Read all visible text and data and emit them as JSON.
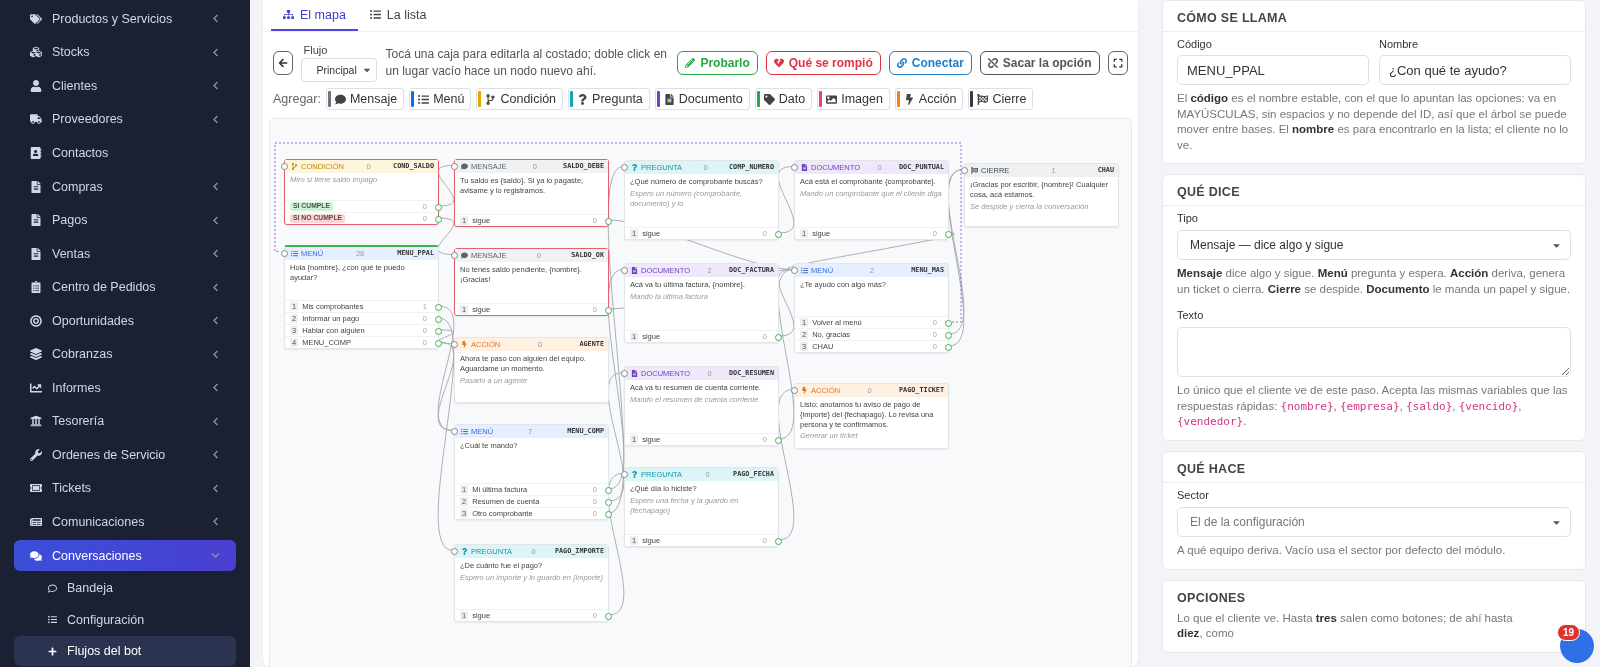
{
  "sidebar": {
    "items": [
      {
        "label": "Productos y Servicios",
        "has_submenu": true,
        "expanded": false,
        "selected": false
      },
      {
        "label": "Stocks",
        "has_submenu": true,
        "expanded": false,
        "selected": false
      },
      {
        "label": "Clientes",
        "has_submenu": true,
        "expanded": false,
        "selected": false
      },
      {
        "label": "Proveedores",
        "has_submenu": true,
        "expanded": false,
        "selected": false
      },
      {
        "label": "Contactos",
        "has_submenu": false,
        "expanded": false,
        "selected": false
      },
      {
        "label": "Compras",
        "has_submenu": true,
        "expanded": false,
        "selected": false
      },
      {
        "label": "Pagos",
        "has_submenu": true,
        "expanded": false,
        "selected": false
      },
      {
        "label": "Ventas",
        "has_submenu": true,
        "expanded": false,
        "selected": false
      },
      {
        "label": "Centro de Pedidos",
        "has_submenu": true,
        "expanded": false,
        "selected": false
      },
      {
        "label": "Oportunidades",
        "has_submenu": true,
        "expanded": false,
        "selected": false
      },
      {
        "label": "Cobranzas",
        "has_submenu": true,
        "expanded": false,
        "selected": false
      },
      {
        "label": "Informes",
        "has_submenu": true,
        "expanded": false,
        "selected": false
      },
      {
        "label": "Tesorería",
        "has_submenu": true,
        "expanded": false,
        "selected": false
      },
      {
        "label": "Ordenes de Servicio",
        "has_submenu": true,
        "expanded": false,
        "selected": false
      },
      {
        "label": "Tickets",
        "has_submenu": true,
        "expanded": false,
        "selected": false
      },
      {
        "label": "Comunicaciones",
        "has_submenu": true,
        "expanded": false,
        "selected": false
      },
      {
        "label": "Conversaciones",
        "has_submenu": true,
        "expanded": true,
        "selected": true,
        "children": [
          {
            "label": "Bandeja",
            "selected": false
          },
          {
            "label": "Configuración",
            "selected": false
          },
          {
            "label": "Flujos del bot",
            "selected": true
          }
        ]
      }
    ]
  },
  "tabs": [
    {
      "label": "El mapa",
      "selected": true
    },
    {
      "label": "La lista",
      "selected": false
    }
  ],
  "toolbar": {
    "flow_label": "Flujo",
    "flow_value": "Principal",
    "hint": "Tocá una caja para editarla al costado; doble click en un lugar vacío hace un nodo nuevo ahí.",
    "buttons": [
      {
        "kind": "test",
        "label": "Probarlo",
        "color": "#28a745"
      },
      {
        "kind": "broken",
        "label": "Qué se rompió",
        "color": "#dc3545"
      },
      {
        "kind": "link",
        "label": "Conectar",
        "color": "#1f7fc8"
      },
      {
        "kind": "unlink",
        "label": "Sacar la opción",
        "color": "#555555"
      }
    ]
  },
  "add_label": "Agregar:",
  "add_buttons": [
    {
      "kind": "mensaje",
      "label": "Mensaje",
      "color": "#6c757d"
    },
    {
      "kind": "menu",
      "label": "Menú",
      "color": "#0d6efd"
    },
    {
      "kind": "condicion",
      "label": "Condición",
      "color": "#e0a800"
    },
    {
      "kind": "pregunta",
      "label": "Pregunta",
      "color": "#17a2b8"
    },
    {
      "kind": "documento",
      "label": "Documento",
      "color": "#6f42c1"
    },
    {
      "kind": "dato",
      "label": "Dato",
      "color": "#28a745"
    },
    {
      "kind": "imagen",
      "label": "Imagen",
      "color": "#e83e8c"
    },
    {
      "kind": "accion",
      "label": "Acción",
      "color": "#fd7e14"
    },
    {
      "kind": "cierre",
      "label": "Cierre",
      "color": "#343a40"
    }
  ],
  "nodes": [
    {
      "kind": "condicion",
      "type_label": "CONDICIÓN",
      "count": "0",
      "code": "COND_SALDO",
      "hint": "Miro si tiene saldo impago",
      "error": true,
      "selected": false,
      "options": [
        {
          "kind": "badge",
          "label": "SI CUMPLE",
          "count": "0",
          "color": "#cdf2d6"
        },
        {
          "kind": "badge",
          "label": "SI NO CUMPLE",
          "count": "0",
          "color": "#fbd5d5"
        }
      ]
    },
    {
      "kind": "menu",
      "type_label": "MENÚ",
      "count": "28",
      "code": "MENU_PPAL",
      "text": "Hola {nombre}, ¿con qué te puedo ayudar?",
      "error": false,
      "selected": true,
      "options": [
        {
          "kind": "numbered",
          "number": "1",
          "label": "Mis comprobantes",
          "count": "1"
        },
        {
          "kind": "numbered",
          "number": "2",
          "label": "Informar un pago",
          "count": "0"
        },
        {
          "kind": "numbered",
          "number": "3",
          "label": "Hablar con alguien",
          "count": "0"
        },
        {
          "kind": "numbered",
          "number": "4",
          "label": "MENU_COMP",
          "count": "0"
        }
      ]
    },
    {
      "kind": "mensaje",
      "type_label": "MENSAJE",
      "count": "0",
      "code": "SALDO_DEBE",
      "text": "Tu saldo es {saldo}. Si ya lo pagaste, avisame y lo registramos.",
      "error": true,
      "selected": false,
      "options": [
        {
          "kind": "numbered",
          "number": "1",
          "label": "sigue",
          "count": "0"
        }
      ]
    },
    {
      "kind": "mensaje",
      "type_label": "MENSAJE",
      "count": "0",
      "code": "SALDO_OK",
      "text": "No tenés saldo pendiente, {nombre}. ¡Gracias!",
      "error": true,
      "selected": false,
      "options": [
        {
          "kind": "numbered",
          "number": "1",
          "label": "sigue",
          "count": "0"
        }
      ]
    },
    {
      "kind": "accion",
      "type_label": "ACCIÓN",
      "count": "0",
      "code": "AGENTE",
      "text": "Ahora te paso con alguien del equipo. Aguardame un momento.",
      "hint": "Pasarlo a un agente",
      "error": false,
      "selected": false
    },
    {
      "kind": "menu",
      "type_label": "MENÚ",
      "count": "7",
      "code": "MENU_COMP",
      "text": "¿Cuál te mando?",
      "error": false,
      "selected": false,
      "options": [
        {
          "kind": "numbered",
          "number": "1",
          "label": "Mi última factura",
          "count": "0"
        },
        {
          "kind": "numbered",
          "number": "2",
          "label": "Resumen de cuenta",
          "count": "0"
        },
        {
          "kind": "numbered",
          "number": "3",
          "label": "Otro comprobante",
          "count": "0"
        }
      ]
    },
    {
      "kind": "pregunta",
      "type_label": "PREGUNTA",
      "count": "0",
      "code": "PAGO_IMPORTE",
      "text": "¿De cuánto fue el pago?",
      "hint": "Espero un importe y lo guardo en {importe}",
      "error": false,
      "selected": false,
      "options": [
        {
          "kind": "numbered",
          "number": "1",
          "label": "sigue",
          "count": "0"
        }
      ]
    },
    {
      "kind": "pregunta",
      "type_label": "PREGUNTA",
      "count": "0",
      "code": "COMP_NUMERO",
      "text": "¿Qué número de comprobante buscás?",
      "hint": "Espero un número (comprobante, documento) y lo",
      "error": false,
      "selected": false,
      "options": [
        {
          "kind": "numbered",
          "number": "1",
          "label": "sigue",
          "count": "0"
        }
      ]
    },
    {
      "kind": "documento",
      "type_label": "DOCUMENTO",
      "count": "2",
      "code": "DOC_FACTURA",
      "text": "Acá va tu última factura, {nombre}.",
      "hint": "Mando la última factura",
      "error": false,
      "selected": false,
      "options": [
        {
          "kind": "numbered",
          "number": "1",
          "label": "sigue",
          "count": "0"
        }
      ]
    },
    {
      "kind": "documento",
      "type_label": "DOCUMENTO",
      "count": "0",
      "code": "DOC_RESUMEN",
      "text": "Acá va tu resumen de cuenta corriente.",
      "hint": "Mando el resumen de cuenta corriente",
      "error": false,
      "selected": false,
      "options": [
        {
          "kind": "numbered",
          "number": "1",
          "label": "sigue",
          "count": "0"
        }
      ]
    },
    {
      "kind": "pregunta",
      "type_label": "PREGUNTA",
      "count": "0",
      "code": "PAGO_FECHA",
      "text": "¿Qué día lo hiciste?",
      "hint": "Espero una fecha y la guardo en {fechapago}",
      "error": false,
      "selected": false,
      "options": [
        {
          "kind": "numbered",
          "number": "1",
          "label": "sigue",
          "count": "0"
        }
      ]
    },
    {
      "kind": "documento",
      "type_label": "DOCUMENTO",
      "count": "0",
      "code": "DOC_PUNTUAL",
      "text": "Acá está el comprobante {comprobante}.",
      "hint": "Mando un comprobante que el cliente diga",
      "error": false,
      "selected": false,
      "options": [
        {
          "kind": "numbered",
          "number": "1",
          "label": "sigue",
          "count": "0"
        }
      ]
    },
    {
      "kind": "menu",
      "type_label": "MENÚ",
      "count": "2",
      "code": "MENU_MAS",
      "text": "¿Te ayudo con algo más?",
      "error": false,
      "selected": false,
      "options": [
        {
          "kind": "numbered",
          "number": "1",
          "label": "Volver al menú",
          "count": "0"
        },
        {
          "kind": "numbered",
          "number": "2",
          "label": "No, gracias",
          "count": "0"
        },
        {
          "kind": "numbered",
          "number": "3",
          "label": "CHAU",
          "count": "0"
        }
      ]
    },
    {
      "kind": "accion",
      "type_label": "ACCIÓN",
      "count": "0",
      "code": "PAGO_TICKET",
      "text": "Listo: anotamos tu aviso de pago de {importe} del {fechapago}. Lo revisa una persona y te confirmamos.",
      "hint": "Generar un ticket",
      "error": false,
      "selected": false
    },
    {
      "kind": "cierre",
      "type_label": "CIERRE",
      "count": "1",
      "code": "CHAU",
      "text": "¡Gracias por escribir, {nombre}! Cualquier cosa, acá estamos.",
      "hint": "Se despide y cierra la conversación",
      "error": false,
      "selected": false
    }
  ],
  "panel": {
    "name_section": {
      "title": "CÓMO SE LLAMA",
      "fields": [
        {
          "label": "Código",
          "value": "MENU_PPAL"
        },
        {
          "label": "Nombre",
          "value": "¿Con qué te ayudo?"
        }
      ],
      "help": "El **código** es el nombre estable, con el que lo apuntan las opciones: va en MAYÚSCULAS, sin espacios y no depende del ID, así que el árbol se puede mover entre bases. El **nombre** es para encontrarlo en la lista; el cliente no lo ve."
    },
    "says_section": {
      "title": "QUÉ DICE",
      "type_label": "Tipo",
      "type_value": "Mensaje — dice algo y sigue",
      "type_help": "**Mensaje** dice algo y sigue. **Menú** pregunta y espera. **Acción** deriva, genera un ticket o cierra. **Cierre** se despide. **Documento** le manda un papel y sigue.",
      "text_label": "Texto",
      "text_help": "Lo único que el cliente ve de este paso. Acepta las mismas variables que las respuestas rápidas: {nombre}, {empresa}, {saldo}, {vencido}, {vendedor}."
    },
    "does_section": {
      "title": "QUÉ HACE",
      "sector_label": "Sector",
      "sector_value": "El de la configuración",
      "help": "A qué equipo deriva. Vacío usa el sector por defecto del módulo."
    },
    "options_section": {
      "title": "OPCIONES",
      "help": "Lo que el cliente ve. Hasta **tres** salen como botones; de ahí hasta **diez**, como"
    }
  },
  "chat_bubble": {
    "badge": "19"
  }
}
